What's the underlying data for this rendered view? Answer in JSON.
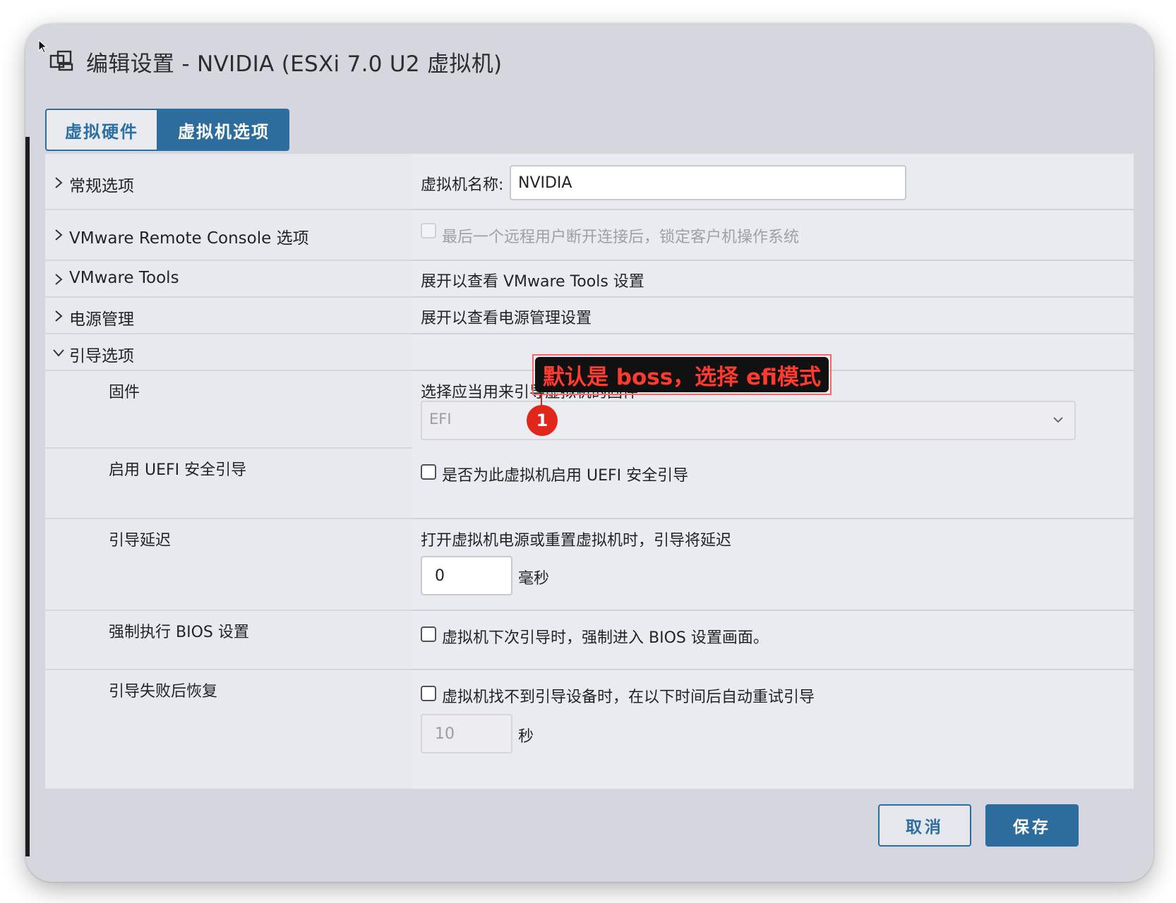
{
  "dialog": {
    "title": "编辑设置 - NVIDIA (ESXi 7.0 U2 虚拟机)",
    "icon": "vm-icon"
  },
  "tabs": [
    {
      "label": "虚拟硬件",
      "active": false
    },
    {
      "label": "虚拟机选项",
      "active": true
    }
  ],
  "sections": {
    "general": {
      "label": "常规选项",
      "vm_name_label": "虚拟机名称:",
      "vm_name_value": "NVIDIA"
    },
    "remote_console": {
      "label": "VMware Remote Console 选项",
      "lock_guest_text": "最后一个远程用户断开连接后，锁定客户机操作系统"
    },
    "tools": {
      "label": "VMware Tools",
      "summary": "展开以查看 VMware Tools 设置"
    },
    "power": {
      "label": "电源管理",
      "summary": "展开以查看电源管理设置"
    },
    "boot": {
      "label": "引导选项",
      "firmware": {
        "label": "固件",
        "description": "选择应当用来引导虚拟机的固件",
        "value": "EFI"
      },
      "secure_boot": {
        "label": "启用 UEFI 安全引导",
        "checkbox_text": "是否为此虚拟机启用 UEFI 安全引导"
      },
      "boot_delay": {
        "label": "引导延迟",
        "description": "打开虚拟机电源或重置虚拟机时，引导将延迟",
        "value": "0",
        "unit": "毫秒"
      },
      "force_bios": {
        "label": "强制执行 BIOS 设置",
        "checkbox_text": "虚拟机下次引导时，强制进入 BIOS 设置画面。"
      },
      "failed_boot": {
        "label": "引导失败后恢复",
        "checkbox_text": "虚拟机找不到引导设备时，在以下时间后自动重试引导",
        "value": "10",
        "unit": "秒"
      }
    }
  },
  "annotation": {
    "text": "默认是 boss，选择 efi模式",
    "marker": "1"
  },
  "footer": {
    "cancel_label": "取消",
    "save_label": "保存"
  },
  "colors": {
    "accent": "#2c6d9e",
    "annotation_red": "#e1261c"
  }
}
